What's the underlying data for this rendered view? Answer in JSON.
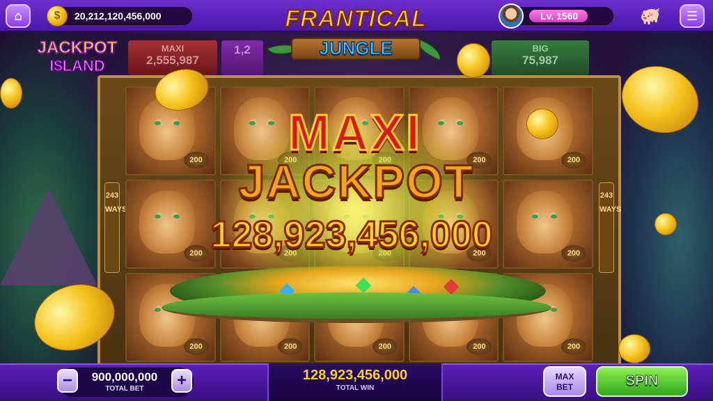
{
  "topbar": {
    "balance": "20,212,120,456,000",
    "level": "Lv. 1560",
    "level_progress": 0.72
  },
  "logos": {
    "game_title_top": "FRANTICAL",
    "game_title_bottom": "JUNGLE",
    "brand_line1": "JACKPOT",
    "brand_line2": "I$LAND"
  },
  "jackpots": {
    "maxi": {
      "label": "MAXI",
      "value": "2,555,987"
    },
    "major": {
      "label": "",
      "value": "1,2"
    },
    "big": {
      "label": "BIG",
      "value": "75,987"
    }
  },
  "reels": {
    "ways_label": "243 WAYS",
    "symbol_value": "200"
  },
  "win_overlay": {
    "line1": "MAXI",
    "line2": "JACKPOT",
    "amount": "128,923,456,000"
  },
  "bottombar": {
    "minus_label": "−",
    "plus_label": "+",
    "total_bet": "900,000,000",
    "total_bet_label": "TOTAL BET",
    "total_win": "128,923,456,000",
    "total_win_label": "TOTAL WIN",
    "max_bet_line1": "MAX",
    "max_bet_line2": "BET",
    "spin_label": "SPIN"
  },
  "icons": {
    "home": "home-icon",
    "coin": "coin-icon",
    "piggy": "piggy-bank-icon",
    "menu": "hamburger-menu-icon"
  },
  "colors": {
    "topbar": "#6d2fd0",
    "spin": "#2fa61c",
    "gold": "#ffd21f"
  }
}
